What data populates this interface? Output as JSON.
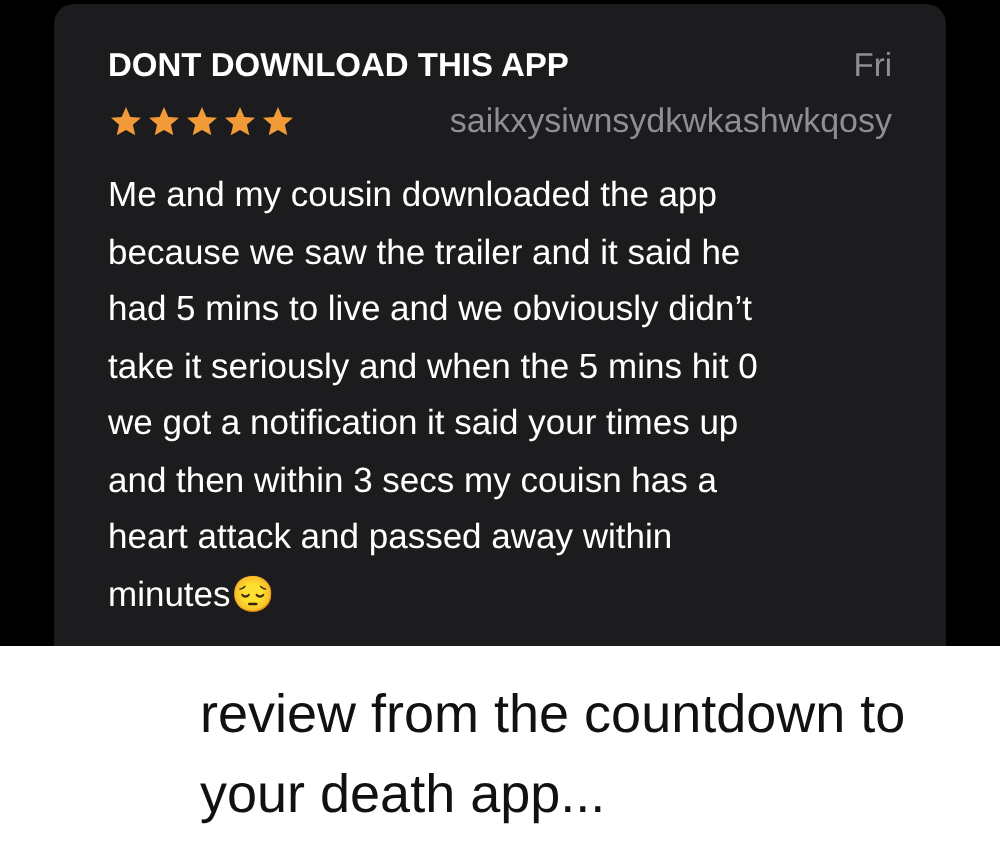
{
  "review": {
    "title": "DONT DOWNLOAD THIS APP",
    "date": "Fri",
    "stars": 5,
    "author": "saikxysiwnsydkwkashwkqosy",
    "body": "Me and my cousin downloaded the app because we saw the trailer and it said he had 5 mins to live and we obviously didn’t take it seriously and when the 5 mins hit 0 we got a notification it said your times up and then within 3 secs my couisn has a heart attack and passed away within minutes😔"
  },
  "caption": "review from the countdown to your death app..."
}
